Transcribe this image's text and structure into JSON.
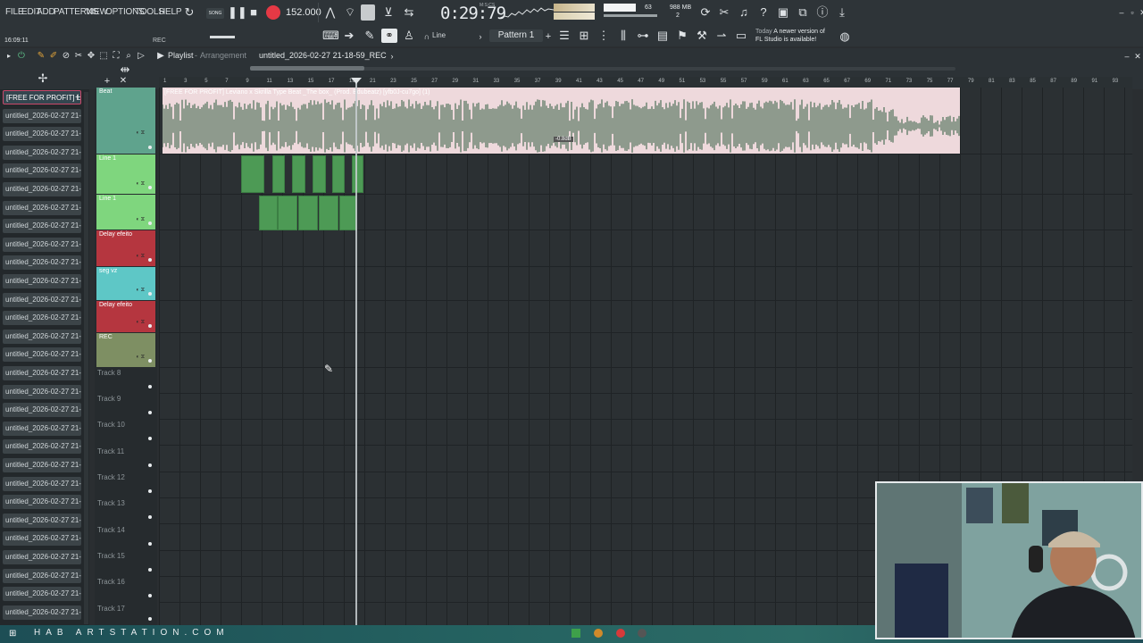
{
  "menu": {
    "items": [
      "FILE",
      "EDIT",
      "ADD",
      "PATTERNS",
      "VIEW",
      "OPTIONS",
      "TOOLS",
      "HELP"
    ]
  },
  "transport": {
    "mode_label": "SONG",
    "tempo": "152.000",
    "time": "0:29:79",
    "time_unit": "M:S:CS",
    "cpu": "63",
    "memory": "988 MB",
    "voices": "2"
  },
  "notification": {
    "day": "Today",
    "text_line1": "A newer version of",
    "text_line2": "FL Studio is available!"
  },
  "toolbar2": {
    "clock": "16:09:11",
    "rec_label": "REC",
    "line_mode": "Line",
    "pattern": "Pattern 1"
  },
  "playlist": {
    "title": "Playlist",
    "subtitle": "Arrangement",
    "file": "untitled_2026-02-27 21-18-59_REC",
    "ruler": [
      "1",
      "3",
      "5",
      "7",
      "9",
      "11",
      "13",
      "15",
      "17",
      "19",
      "21",
      "23",
      "25",
      "27",
      "29",
      "31",
      "33",
      "35",
      "37",
      "39",
      "41",
      "43",
      "45",
      "47",
      "49",
      "51",
      "53",
      "55",
      "57",
      "59",
      "61",
      "63",
      "65",
      "67",
      "69",
      "71",
      "73",
      "75",
      "77",
      "79",
      "81",
      "83",
      "85",
      "87",
      "89",
      "91",
      "93"
    ]
  },
  "browser": {
    "items": [
      "[FREE FOR PROFIT] L...",
      "untitled_2026-02-27 21-...",
      "untitled_2026-02-27 21-...",
      "untitled_2026-02-27 21-...",
      "untitled_2026-02-27 21-...",
      "untitled_2026-02-27 21-...",
      "untitled_2026-02-27 21-...",
      "untitled_2026-02-27 21-...",
      "untitled_2026-02-27 21-...",
      "untitled_2026-02-27 21-...",
      "untitled_2026-02-27 21-...",
      "untitled_2026-02-27 21-...",
      "untitled_2026-02-27 21-...",
      "untitled_2026-02-27 21-...",
      "untitled_2026-02-27 21-...",
      "untitled_2026-02-27 21-...",
      "untitled_2026-02-27 21-...",
      "untitled_2026-02-27 21-...",
      "untitled_2026-02-27 21-...",
      "untitled_2026-02-27 21-...",
      "untitled_2026-02-27 21-...",
      "untitled_2026-02-27 21-...",
      "untitled_2026-02-27 21-...",
      "untitled_2026-02-27 21-...",
      "untitled_2026-02-27 21-...",
      "untitled_2026-02-27 21-...",
      "untitled_2026-02-27 21-...",
      "untitled_2026-02-27 21-...",
      "untitled_2026-02-27 21-..."
    ]
  },
  "tracks": [
    {
      "name": "Beat",
      "color": "#5fa38d"
    },
    {
      "name": "Line 1",
      "color": "#7fd67e"
    },
    {
      "name": "Line 1",
      "color": "#7fd67e"
    },
    {
      "name": "Delay efeito",
      "color": "#b5363f"
    },
    {
      "name": "seg vz",
      "color": "#5ec7c6"
    },
    {
      "name": "Delay efeito",
      "color": "#b5363f"
    },
    {
      "name": "REC",
      "color": "#7e8f63"
    },
    {
      "name": "Track 8"
    },
    {
      "name": "Track 9"
    },
    {
      "name": "Track 10"
    },
    {
      "name": "Track 11"
    },
    {
      "name": "Track 12"
    },
    {
      "name": "Track 13"
    },
    {
      "name": "Track 14"
    },
    {
      "name": "Track 15"
    },
    {
      "name": "Track 16"
    },
    {
      "name": "Track 17"
    }
  ],
  "clip": {
    "beat_title": "[FREE FOR PROFIT] Leviano x Skrilla Type Beat _The box_ (Prod. Edubeatz) [yfb0J-cu7go] (1)",
    "db_label": "-0.8dB"
  },
  "taskbar": {
    "watermark": "HAB ARTSTATION.COM"
  }
}
